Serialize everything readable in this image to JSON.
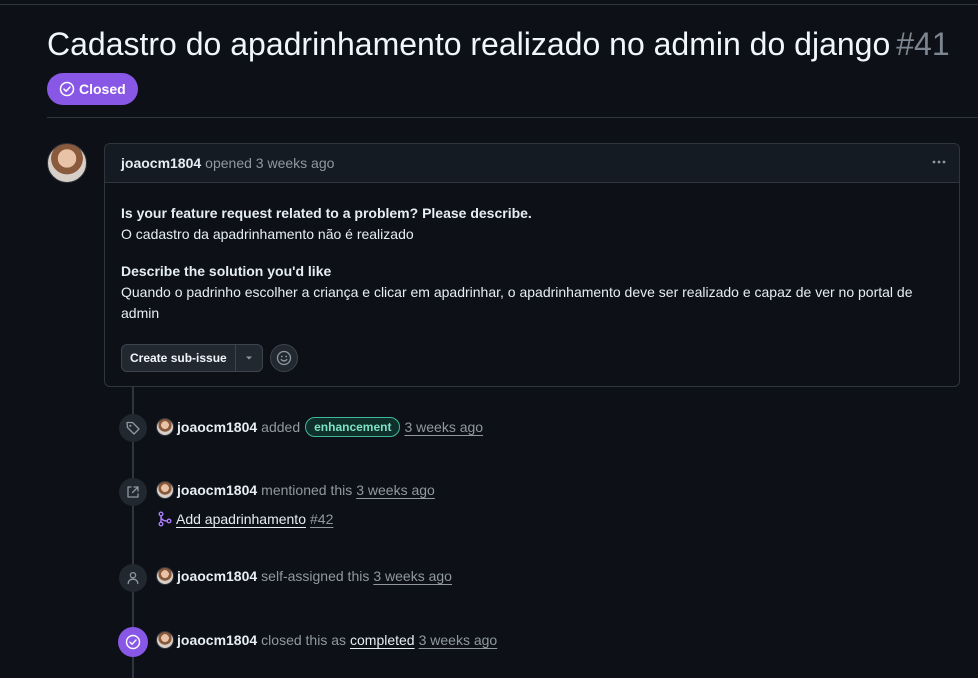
{
  "issue": {
    "title": "Cadastro do apadrinhamento realizado no admin do django",
    "number": "#41",
    "state": "Closed",
    "state_color": "#8957e5"
  },
  "comment": {
    "author": "joaocm1804",
    "meta": "opened 3 weeks ago",
    "q1": "Is your feature request related to a problem? Please describe.",
    "a1": "O cadastro da apadrinhamento não é realizado",
    "q2": "Describe the solution you'd like",
    "a2": "Quando o padrinho escolher a criança e clicar em apadrinhar, o apadrinhamento deve ser realizado e capaz de ver no portal de admin",
    "sub_issue_button": "Create sub-issue"
  },
  "timeline": {
    "label_event": {
      "author": "joaocm1804",
      "action": "added",
      "label": "enhancement",
      "label_color": "#3fb99e",
      "time": "3 weeks ago"
    },
    "mention_event": {
      "author": "joaocm1804",
      "action": "mentioned this",
      "time": "3 weeks ago",
      "pr_title": "Add apadrinhamento",
      "pr_number": "#42"
    },
    "assign_event": {
      "author": "joaocm1804",
      "action": "self-assigned this",
      "time": "3 weeks ago"
    },
    "close_event": {
      "author": "joaocm1804",
      "action": "closed this as",
      "reason": "completed",
      "time": "3 weeks ago"
    }
  }
}
